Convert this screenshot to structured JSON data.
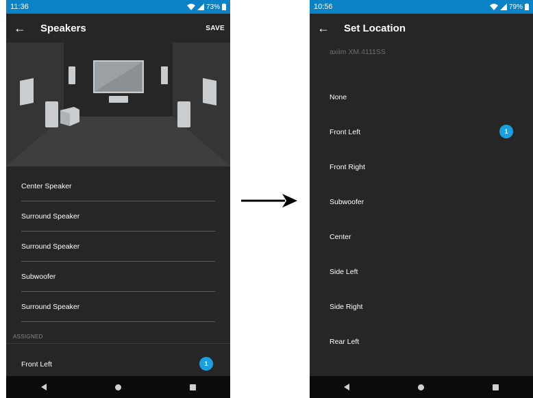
{
  "left_screen": {
    "status": {
      "time": "11:36",
      "battery": "73%"
    },
    "title": "Speakers",
    "save_label": "SAVE",
    "speaker_list": [
      {
        "label": "Center Speaker"
      },
      {
        "label": "Surround Speaker"
      },
      {
        "label": "Surround Speaker"
      },
      {
        "label": "Subwoofer"
      },
      {
        "label": "Surround Speaker"
      }
    ],
    "section_label": "ASSIGNED",
    "assigned": [
      {
        "label": "Front Left",
        "badge": "1"
      }
    ]
  },
  "right_screen": {
    "status": {
      "time": "10:56",
      "battery": "79%"
    },
    "title": "Set Location",
    "device_name": "axiim XM.4111SS",
    "locations": [
      {
        "label": "None",
        "badge": ""
      },
      {
        "label": "Front Left",
        "badge": "1"
      },
      {
        "label": "Front Right",
        "badge": ""
      },
      {
        "label": "Subwoofer",
        "badge": ""
      },
      {
        "label": "Center",
        "badge": ""
      },
      {
        "label": "Side Left",
        "badge": ""
      },
      {
        "label": "Side Right",
        "badge": ""
      },
      {
        "label": "Rear Left",
        "badge": ""
      }
    ]
  },
  "icons": {
    "back": "arrow-left-icon",
    "nav_back": "triangle-back-icon",
    "nav_home": "circle-home-icon",
    "nav_recent": "square-recent-icon",
    "wifi": "wifi-icon",
    "signal": "signal-icon",
    "battery": "battery-icon"
  },
  "colors": {
    "status_bar": "#0b82c6",
    "background": "#262626",
    "badge": "#1aa0e0",
    "nav_bar": "#0b0b0b"
  }
}
